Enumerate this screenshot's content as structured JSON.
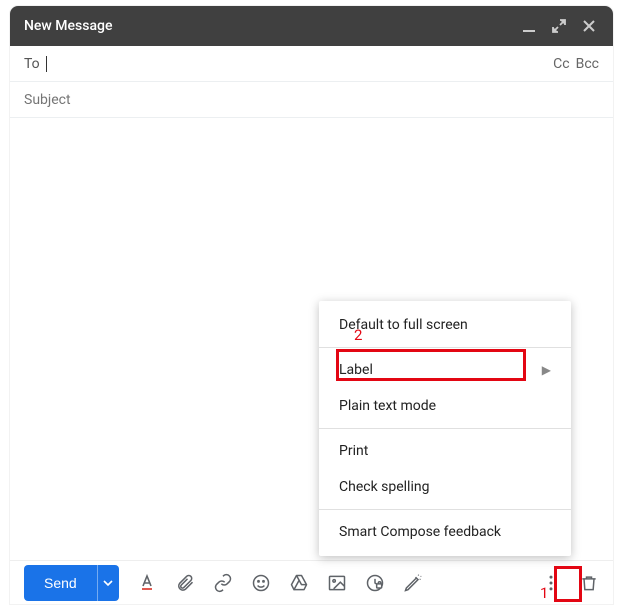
{
  "header": {
    "title": "New Message"
  },
  "to": {
    "label": "To",
    "cc": "Cc",
    "bcc": "Bcc"
  },
  "subject": {
    "placeholder": "Subject"
  },
  "send": {
    "label": "Send"
  },
  "menu": {
    "full_screen": "Default to full screen",
    "label": "Label",
    "plain_text": "Plain text mode",
    "print": "Print",
    "spelling": "Check spelling",
    "smart_compose": "Smart Compose feedback"
  },
  "annotations": {
    "n1": "1",
    "n2": "2"
  }
}
